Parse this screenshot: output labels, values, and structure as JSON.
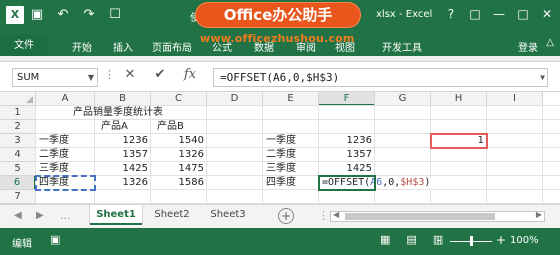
{
  "titlebar": {
    "app_icon": "X",
    "qat_icons": [
      "save-icon",
      "undo-icon",
      "redo-icon",
      "touch-icon"
    ],
    "qat_glyphs": [
      "▣",
      "↶",
      "↷",
      "☐"
    ],
    "title_left": "使用",
    "title_right": "xlsx - Excel",
    "ctrl_glyphs": [
      "?",
      "□",
      "—",
      "□",
      "✕"
    ],
    "watermark": "Office办公助手",
    "watermark_url": "www.officezhushou.com"
  },
  "ribbon": {
    "file_tab": "文件",
    "tabs": [
      "开始",
      "插入",
      "页面布局",
      "公式",
      "数据",
      "审阅",
      "视图",
      "开发工具"
    ],
    "login": "登录",
    "collapse_glyph": "△"
  },
  "formula_bar": {
    "name_box": "SUM",
    "cancel_glyph": "✕",
    "enter_glyph": "✔",
    "fx_glyph": "fx",
    "formula": "=OFFSET(A6,0,$H$3)"
  },
  "columns": [
    "A",
    "B",
    "C",
    "D",
    "E",
    "F",
    "G",
    "H",
    "I"
  ],
  "rows": [
    "1",
    "2",
    "3",
    "4",
    "5",
    "6",
    "7"
  ],
  "cells": {
    "title": "产品销量季度统计表",
    "header_a": "产品A",
    "header_b": "产品B",
    "left_table": [
      {
        "label": "一季度",
        "a": "1236",
        "b": "1540"
      },
      {
        "label": "二季度",
        "a": "1357",
        "b": "1326"
      },
      {
        "label": "三季度",
        "a": "1425",
        "b": "1475"
      },
      {
        "label": "四季度",
        "a": "1326",
        "b": "1586"
      }
    ],
    "right_table": [
      {
        "label": "一季度",
        "value": "1236"
      },
      {
        "label": "二季度",
        "value": "1357"
      },
      {
        "label": "三季度",
        "value": "1425"
      },
      {
        "label": "四季度",
        "value": ""
      }
    ],
    "h3": "1",
    "f6_formula": {
      "prefix": "=OFFSET(",
      "ref1": "A6",
      "mid": ",0,",
      "ref2": "$H$3",
      "suffix": ")"
    }
  },
  "sheets": {
    "tabs": [
      "Sheet1",
      "Sheet2",
      "Sheet3"
    ],
    "active": "Sheet1",
    "add_glyph": "+",
    "nav_glyphs": [
      "◀",
      "▶"
    ],
    "dots": "..."
  },
  "statusbar": {
    "mode": "编辑",
    "rec_glyph": "▣",
    "view_glyphs": [
      "▦",
      "▤",
      "▥"
    ],
    "zoom_minus": "-",
    "zoom_plus": "+",
    "zoom": "100%",
    "zoom_level": 1.0
  },
  "colors": {
    "excel_green": "#217346",
    "watermark_orange": "#e8561c",
    "ref_blue": "#4472c4",
    "ref_red": "#e55b59"
  }
}
